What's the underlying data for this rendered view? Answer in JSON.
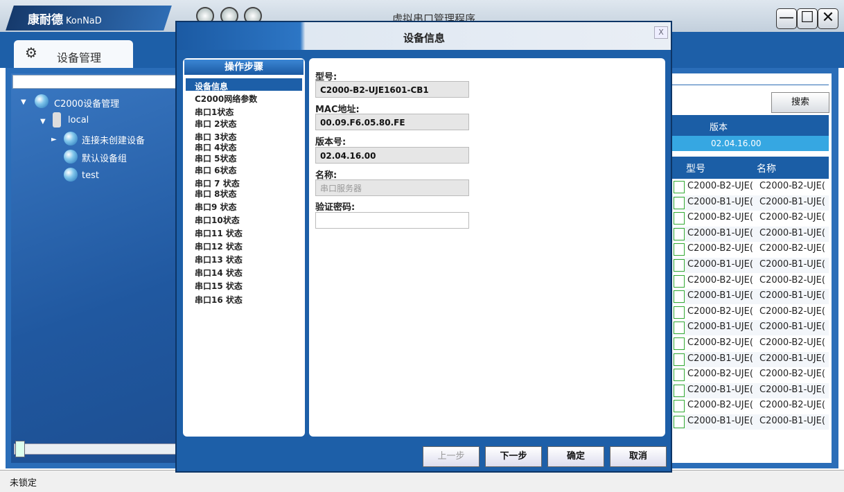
{
  "app": {
    "title": "虚拟串口管理程序",
    "logo_text": "康耐德",
    "logo_brand": "KonNaD",
    "win_controls": [
      "—",
      "☐",
      "✕"
    ]
  },
  "tab": {
    "label": "设备管理",
    "icon": "gear-icon"
  },
  "tree": {
    "root": "C2000设备管理",
    "local": "local",
    "items": [
      "连接未创建设备",
      "默认设备组",
      "test"
    ]
  },
  "right": {
    "search_label": "搜索",
    "version_header": "版本",
    "version_value": "02.04.16.00",
    "columns": [
      "型号",
      "名称"
    ],
    "rows": [
      [
        "C2000-B2-UJE(",
        "C2000-B2-UJE("
      ],
      [
        "C2000-B1-UJE(",
        "C2000-B1-UJE("
      ],
      [
        "C2000-B2-UJE(",
        "C2000-B2-UJE("
      ],
      [
        "C2000-B1-UJE(",
        "C2000-B1-UJE("
      ],
      [
        "C2000-B2-UJE(",
        "C2000-B2-UJE("
      ],
      [
        "C2000-B1-UJE(",
        "C2000-B1-UJE("
      ],
      [
        "C2000-B2-UJE(",
        "C2000-B2-UJE("
      ],
      [
        "C2000-B1-UJE(",
        "C2000-B1-UJE("
      ],
      [
        "C2000-B2-UJE(",
        "C2000-B2-UJE("
      ],
      [
        "C2000-B1-UJE(",
        "C2000-B1-UJE("
      ],
      [
        "C2000-B2-UJE(",
        "C2000-B2-UJE("
      ],
      [
        "C2000-B1-UJE(",
        "C2000-B1-UJE("
      ],
      [
        "C2000-B2-UJE(",
        "C2000-B2-UJE("
      ],
      [
        "C2000-B1-UJE(",
        "C2000-B1-UJE("
      ],
      [
        "C2000-B2-UJE(",
        "C2000-B2-UJE("
      ],
      [
        "C2000-B1-UJE(",
        "C2000-B1-UJE("
      ]
    ]
  },
  "status": {
    "text": "未锁定"
  },
  "dialog": {
    "title": "设备信息",
    "close": "X",
    "steps_header": "操作步骤",
    "steps": [
      "设备信息",
      "C2000网络参数",
      "串口1状态",
      "串口 2状态",
      "串口 3状态",
      "串口 4状态",
      "串口 5状态",
      "串口 6状态",
      "串口 7 状态",
      "串口 8状态",
      "串口9 状态",
      "串口10状态",
      "串口11 状态",
      "串口12 状态",
      "串口13 状态",
      "串口14 状态",
      "串口15 状态",
      "串口16 状态"
    ],
    "fields": {
      "model_label": "型号:",
      "model_value": "C2000-B2-UJE1601-CB1",
      "mac_label": "MAC地址:",
      "mac_value": "00.09.F6.05.80.FE",
      "version_label": "版本号:",
      "version_value": "02.04.16.00",
      "name_label": "名称:",
      "name_placeholder": "串口服务器",
      "pwd_label": "验证密码:",
      "pwd_value": ""
    },
    "buttons": {
      "prev": "上一步",
      "next": "下一步",
      "ok": "确定",
      "cancel": "取消"
    }
  }
}
